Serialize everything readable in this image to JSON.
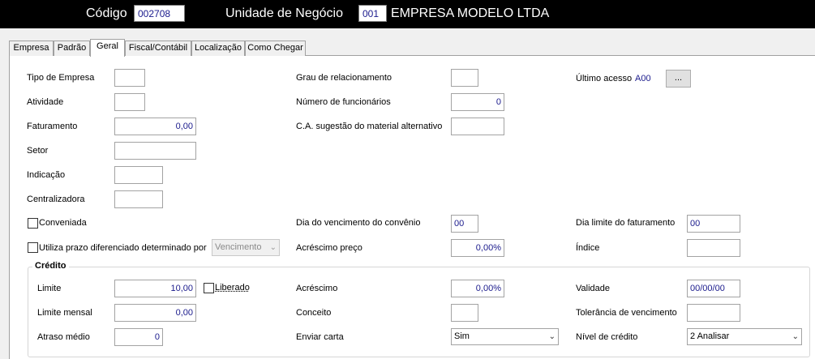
{
  "header": {
    "codigo_label": "Código",
    "codigo_value": "002708",
    "unidade_label": "Unidade de Negócio",
    "unidade_code": "001",
    "unidade_name": "EMPRESA MODELO LTDA"
  },
  "tabs": [
    "Empresa",
    "Padrão",
    "Geral",
    "Fiscal/Contábil",
    "Localização",
    "Como Chegar"
  ],
  "active_tab": "Geral",
  "form": {
    "tipo_empresa": {
      "label": "Tipo de Empresa",
      "value": ""
    },
    "atividade": {
      "label": "Atividade",
      "value": ""
    },
    "faturamento": {
      "label": "Faturamento",
      "value": "0,00"
    },
    "setor": {
      "label": "Setor",
      "value": ""
    },
    "indicacao": {
      "label": "Indicação",
      "value": ""
    },
    "centralizadora": {
      "label": "Centralizadora",
      "value": ""
    },
    "grau_relacionamento": {
      "label": "Grau de relacionamento",
      "value": ""
    },
    "numero_funcionarios": {
      "label": "Número de funcionários",
      "value": "0"
    },
    "ca_sugestao": {
      "label": "C.A. sugestão do material alternativo",
      "value": ""
    },
    "ultimo_acesso": {
      "label": "Último acesso",
      "value": "A00",
      "button": "..."
    },
    "conveniada": {
      "label": "Conveniada",
      "checked": false
    },
    "utiliza_prazo": {
      "label": "Utiliza prazo diferenciado determinado por",
      "checked": false,
      "select": "Vencimento"
    },
    "dia_vencimento": {
      "label": "Dia do vencimento do convênio",
      "value": "00"
    },
    "acrescimo_preco": {
      "label": "Acréscimo preço",
      "value": "0,00%"
    },
    "dia_limite": {
      "label": "Dia limite do faturamento",
      "value": "00"
    },
    "indice": {
      "label": "Índice",
      "value": ""
    }
  },
  "credito": {
    "title": "Crédito",
    "limite": {
      "label": "Limite",
      "value": "10,00"
    },
    "liberado": {
      "label": "Liberado",
      "checked": false
    },
    "limite_mensal": {
      "label": "Limite mensal",
      "value": "0,00"
    },
    "atraso_medio": {
      "label": "Atraso médio",
      "value": "0"
    },
    "acrescimo": {
      "label": "Acréscimo",
      "value": "0,00%"
    },
    "conceito": {
      "label": "Conceito",
      "value": ""
    },
    "enviar_carta": {
      "label": "Enviar carta",
      "value": "Sim"
    },
    "validade": {
      "label": "Validade",
      "value": "00/00/00"
    },
    "tolerancia": {
      "label": "Tolerância de vencimento",
      "value": ""
    },
    "nivel_credito": {
      "label": "Nível de crédito",
      "value": "2 Analisar"
    }
  }
}
